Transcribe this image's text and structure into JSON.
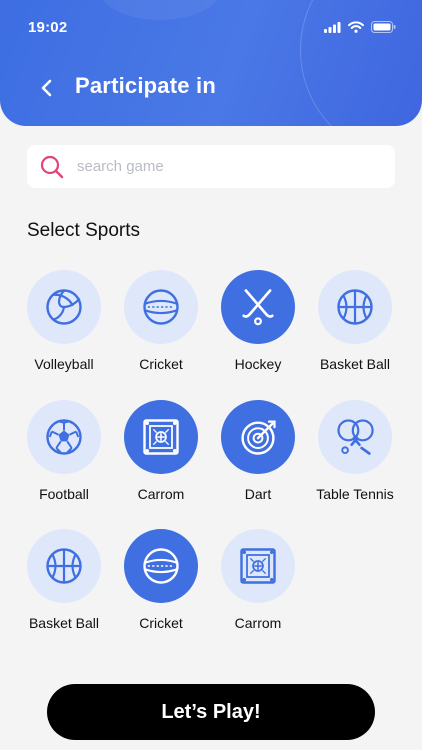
{
  "status_bar": {
    "time": "19:02"
  },
  "header": {
    "title": "Participate in"
  },
  "search": {
    "placeholder": "search game",
    "value": ""
  },
  "section": {
    "title": "Select Sports"
  },
  "colors": {
    "primary": "#3f6fe0",
    "light": "#dfe7fb",
    "search_icon": "#e0457b",
    "button": "#000000"
  },
  "sports": [
    {
      "label": "Volleyball",
      "icon": "volleyball-icon",
      "selected": false
    },
    {
      "label": "Cricket",
      "icon": "cricket-ball-icon",
      "selected": false
    },
    {
      "label": "Hockey",
      "icon": "hockey-sticks-icon",
      "selected": true
    },
    {
      "label": "Basket Ball",
      "icon": "basketball-icon",
      "selected": false
    },
    {
      "label": "Football",
      "icon": "football-icon",
      "selected": false
    },
    {
      "label": "Carrom",
      "icon": "carrom-board-icon",
      "selected": true
    },
    {
      "label": "Dart",
      "icon": "dartboard-icon",
      "selected": true
    },
    {
      "label": "Table Tennis",
      "icon": "table-tennis-icon",
      "selected": false
    },
    {
      "label": "Basket Ball",
      "icon": "basketball-icon",
      "selected": false
    },
    {
      "label": "Cricket",
      "icon": "cricket-ball-icon",
      "selected": true
    },
    {
      "label": "Carrom",
      "icon": "carrom-board-icon",
      "selected": false
    }
  ],
  "cta": {
    "label": "Let’s Play!"
  }
}
